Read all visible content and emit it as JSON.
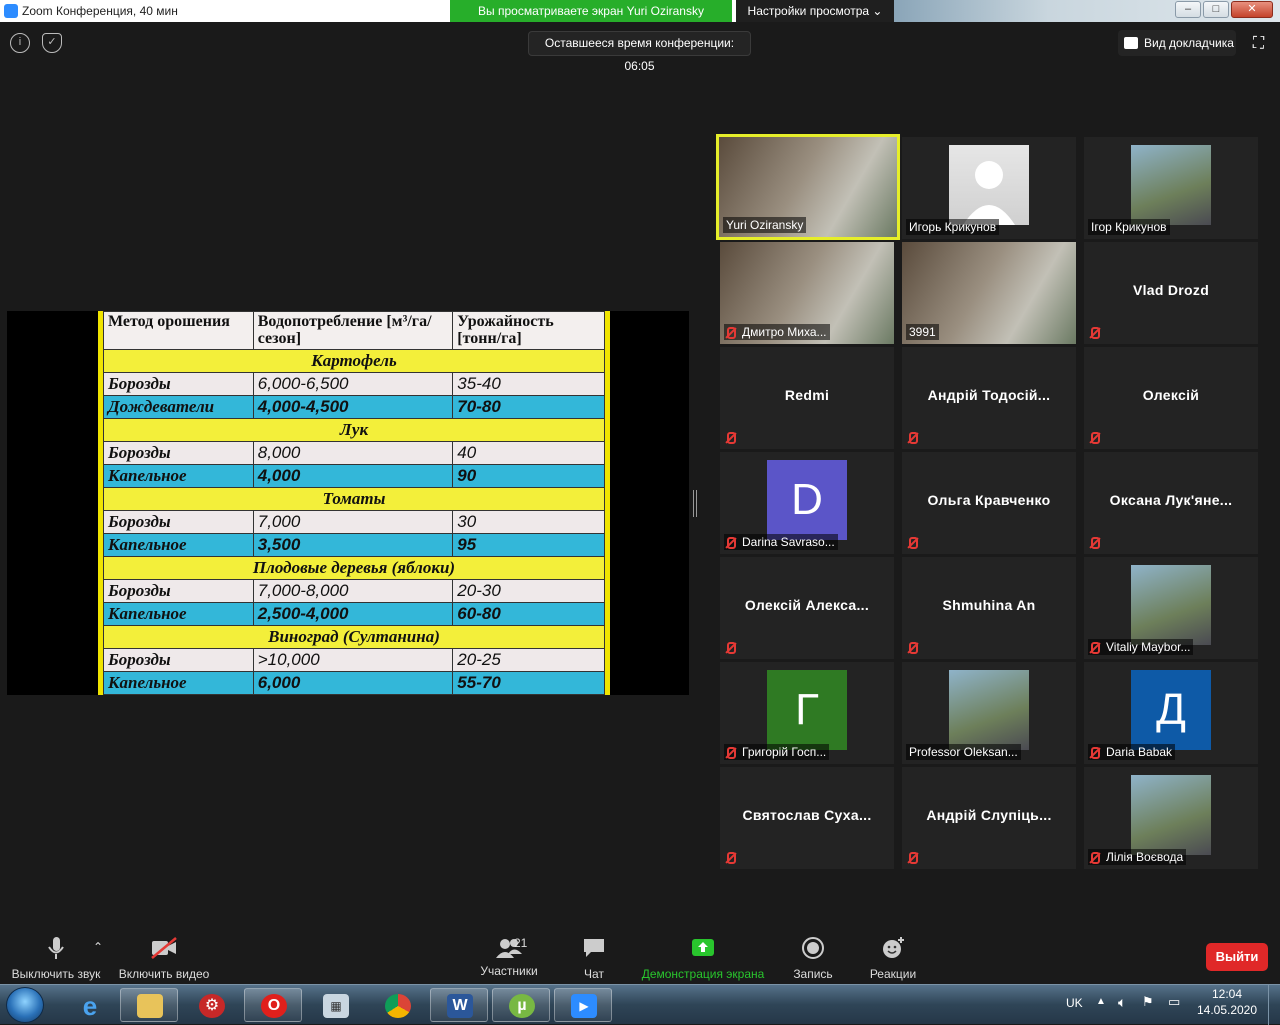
{
  "window": {
    "title": "Zoom Конференция, 40 мин",
    "viewing_banner": "Вы просматриваете экран Yuri Oziransky",
    "view_settings": "Настройки просмотра"
  },
  "topbar": {
    "remaining_time": "Оставшееся время конференции: 06:05",
    "speaker_view": "Вид докладчика"
  },
  "shared_table": {
    "headers": [
      "Метод орошения",
      "Водопотребление [м³/га/сезон]",
      "Урожайность [тонн/га]"
    ],
    "sections": [
      {
        "name": "Картофель",
        "rows": [
          [
            "Борозды",
            "6,000-6,500",
            "35-40"
          ],
          [
            "Дождеватели",
            "4,000-4,500",
            "70-80"
          ]
        ]
      },
      {
        "name": "Лук",
        "rows": [
          [
            "Борозды",
            "8,000",
            "40"
          ],
          [
            "Капельное",
            "4,000",
            "90"
          ]
        ]
      },
      {
        "name": "Томаты",
        "rows": [
          [
            "Борозды",
            "7,000",
            "30"
          ],
          [
            "Капельное",
            "3,500",
            "95"
          ]
        ]
      },
      {
        "name": "Плодовые деревья (яблоки)",
        "rows": [
          [
            "Борозды",
            "7,000-8,000",
            "20-30"
          ],
          [
            "Капельное",
            "2,500-4,000",
            "60-80"
          ]
        ]
      },
      {
        "name": "Виноград (Султанина)",
        "rows": [
          [
            "Борозды",
            ">10,000",
            "20-25"
          ],
          [
            "Капельное",
            "6,000",
            "55-70"
          ]
        ]
      }
    ]
  },
  "participants": [
    {
      "name": "Yuri Oziransky",
      "type": "video",
      "muted": false,
      "active": true
    },
    {
      "name": "Игорь Крикунов",
      "type": "photo",
      "muted": false
    },
    {
      "name": "Ігор Крикунов",
      "type": "photo",
      "muted": false
    },
    {
      "name": "Дмитро Миха...",
      "type": "video",
      "muted": true
    },
    {
      "name": "3991",
      "type": "video",
      "muted": false
    },
    {
      "name": "Vlad Drozd",
      "type": "text",
      "muted": true
    },
    {
      "name": "Redmi",
      "type": "text",
      "muted": true
    },
    {
      "name": "Андрій Тодосій...",
      "type": "text",
      "muted": true
    },
    {
      "name": "Олексій",
      "type": "text",
      "muted": true
    },
    {
      "name": "Darina Savraso...",
      "type": "letter",
      "letter": "D",
      "color": "#5b55c8",
      "muted": true
    },
    {
      "name": "Ольга Кравченко",
      "type": "text",
      "muted": true
    },
    {
      "name": "Оксана Лук'яне...",
      "type": "text",
      "muted": true
    },
    {
      "name": "Олексій Алекса...",
      "type": "text",
      "muted": true
    },
    {
      "name": "Shmuhina An",
      "type": "text",
      "muted": true
    },
    {
      "name": "Vitaliy Maybor...",
      "type": "photo",
      "muted": true
    },
    {
      "name": "Григорій Госп...",
      "type": "letter",
      "letter": "Г",
      "color": "#2f7a23",
      "muted": true
    },
    {
      "name": "Professor Oleksan...",
      "type": "photo",
      "muted": false
    },
    {
      "name": "Daria Babak",
      "type": "letter",
      "letter": "Д",
      "color": "#0e5aa7",
      "muted": true
    },
    {
      "name": "Святослав Суха...",
      "type": "text",
      "muted": true
    },
    {
      "name": "Андрій Слупіць...",
      "type": "text",
      "muted": true
    },
    {
      "name": "Лілія Воєвода",
      "type": "photo",
      "muted": true
    }
  ],
  "toolbar": {
    "mute": "Выключить звук",
    "video": "Включить видео",
    "participants": "Участники",
    "participants_count": "21",
    "chat": "Чат",
    "share": "Демонстрация экрана",
    "record": "Запись",
    "reactions": "Реакции",
    "leave": "Выйти"
  },
  "taskbar": {
    "lang": "UK",
    "time": "12:04",
    "date": "14.05.2020"
  }
}
